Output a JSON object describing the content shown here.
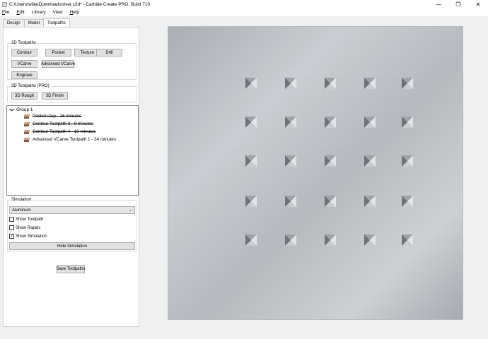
{
  "window": {
    "title": "C:\\Users\\willa\\Downloads\\rivet.c2d* - Carbide Create PRO, Build 710",
    "minimize": "—",
    "maximize": "❐",
    "close": "✕"
  },
  "menu": [
    {
      "label": "File",
      "u": "F",
      "rest": "ile"
    },
    {
      "label": "Edit",
      "u": "E",
      "rest": "dit"
    },
    {
      "label": "Library",
      "u": "",
      "rest": "Library"
    },
    {
      "label": "View",
      "u": "",
      "rest": "View"
    },
    {
      "label": "Help",
      "u": "H",
      "rest": "elp"
    }
  ],
  "tabs": {
    "design": "Design",
    "model": "Model",
    "toolpaths": "Toolpaths",
    "active": "Toolpaths"
  },
  "toolpaths_2d": {
    "label": "2D Toolpaths",
    "contour": "Contour",
    "pocket": "Pocket",
    "texture": "Texture",
    "drill": "Drill",
    "vcarve": "VCarve",
    "advanced_vcarve": "Advanced VCarve",
    "engrave": "Engrave"
  },
  "toolpaths_3d": {
    "label": "3D Toolpaths (PRO)",
    "rough": "3D Rough",
    "finish": "3D Finish"
  },
  "tree": {
    "chevron": "❯",
    "group": "Group 1",
    "items": [
      {
        "label": "Pocket step - 16 minutes",
        "disabled": true
      },
      {
        "label": "Contour Toolpath 3 - 9 minutes",
        "disabled": true
      },
      {
        "label": "Contour Toolpath 4 - 10 minutes",
        "disabled": true
      },
      {
        "label": "Advanced VCarve Toolpath 1 - 24 minutes",
        "disabled": false
      }
    ]
  },
  "simulation": {
    "label": "Simulation",
    "material": "Aluminum",
    "dropdown_arrow": "⌄",
    "show_toolpath": {
      "label": "Show Toolpath",
      "checked": false
    },
    "show_rapids": {
      "label": "Show Rapids",
      "checked": false
    },
    "show_simulation": {
      "label": "Show Simulation",
      "checked": true
    },
    "check_glyph": "✓",
    "hide_button": "Hide Simulation"
  },
  "save_button": "Save Toolpaths",
  "colors": {
    "metal_light": "#c8ccd0",
    "metal_dark": "#9ea3a8",
    "rivet_dark": "#6f7378",
    "rivet_light": "#e2e4e6"
  },
  "rivet_grid": {
    "rows": 5,
    "cols": 5
  }
}
